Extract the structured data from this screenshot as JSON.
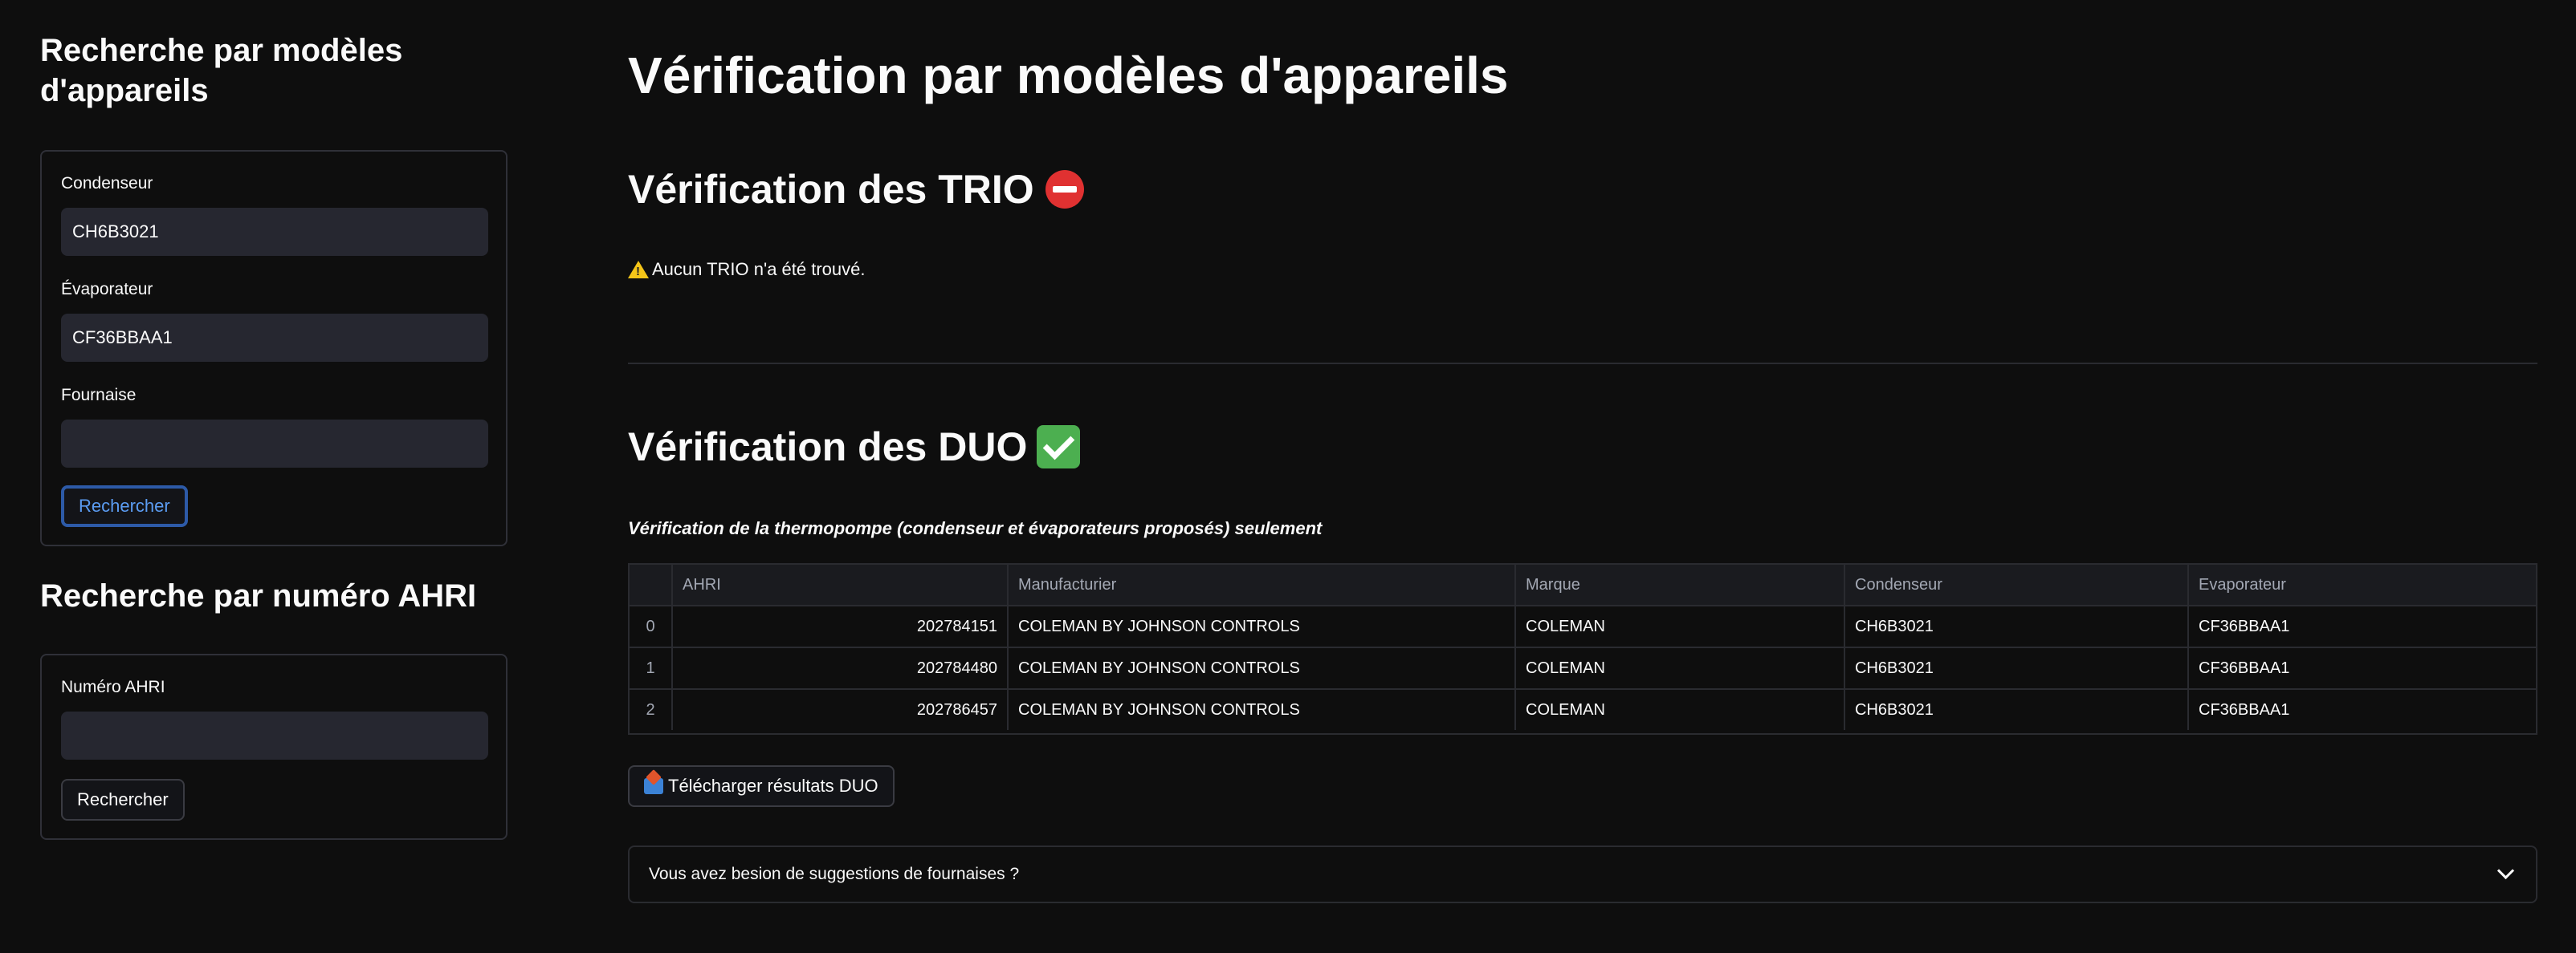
{
  "sidebar": {
    "model_search_title": "Recherche par modèles d'appareils",
    "condenseur_label": "Condenseur",
    "condenseur_value": "CH6B3021",
    "evaporateur_label": "Évaporateur",
    "evaporateur_value": "CF36BBAA1",
    "fournaise_label": "Fournaise",
    "fournaise_value": "",
    "search_button": "Rechercher",
    "ahri_search_title": "Recherche par numéro AHRI",
    "ahri_label": "Numéro AHRI",
    "ahri_value": "",
    "ahri_search_button": "Rechercher"
  },
  "main": {
    "title": "Vérification par modèles d'appareils",
    "trio_title": "Vérification des TRIO",
    "trio_status_icon": "no-entry-icon",
    "trio_warning": "Aucun TRIO n'a été trouvé.",
    "duo_title": "Vérification des DUO",
    "duo_status_icon": "check-mark-icon",
    "duo_caption": "Vérification de la thermopompe (condenseur et évaporateurs proposés) seulement",
    "table": {
      "columns": [
        "",
        "AHRI",
        "Manufacturier",
        "Marque",
        "Condenseur",
        "Evaporateur"
      ],
      "rows": [
        [
          "0",
          "202784151",
          "COLEMAN BY JOHNSON CONTROLS",
          "COLEMAN",
          "CH6B3021",
          "CF36BBAA1"
        ],
        [
          "1",
          "202784480",
          "COLEMAN BY JOHNSON CONTROLS",
          "COLEMAN",
          "CH6B3021",
          "CF36BBAA1"
        ],
        [
          "2",
          "202786457",
          "COLEMAN BY JOHNSON CONTROLS",
          "COLEMAN",
          "CH6B3021",
          "CF36BBAA1"
        ]
      ]
    },
    "download_button": "Télécharger résultats DUO",
    "expander_label": "Vous avez besion de suggestions de fournaises ?"
  },
  "colors": {
    "background": "#0e0e0e",
    "input_bg": "#262730",
    "primary_border": "#2d5aa7",
    "primary_text": "#5b9cf2"
  }
}
